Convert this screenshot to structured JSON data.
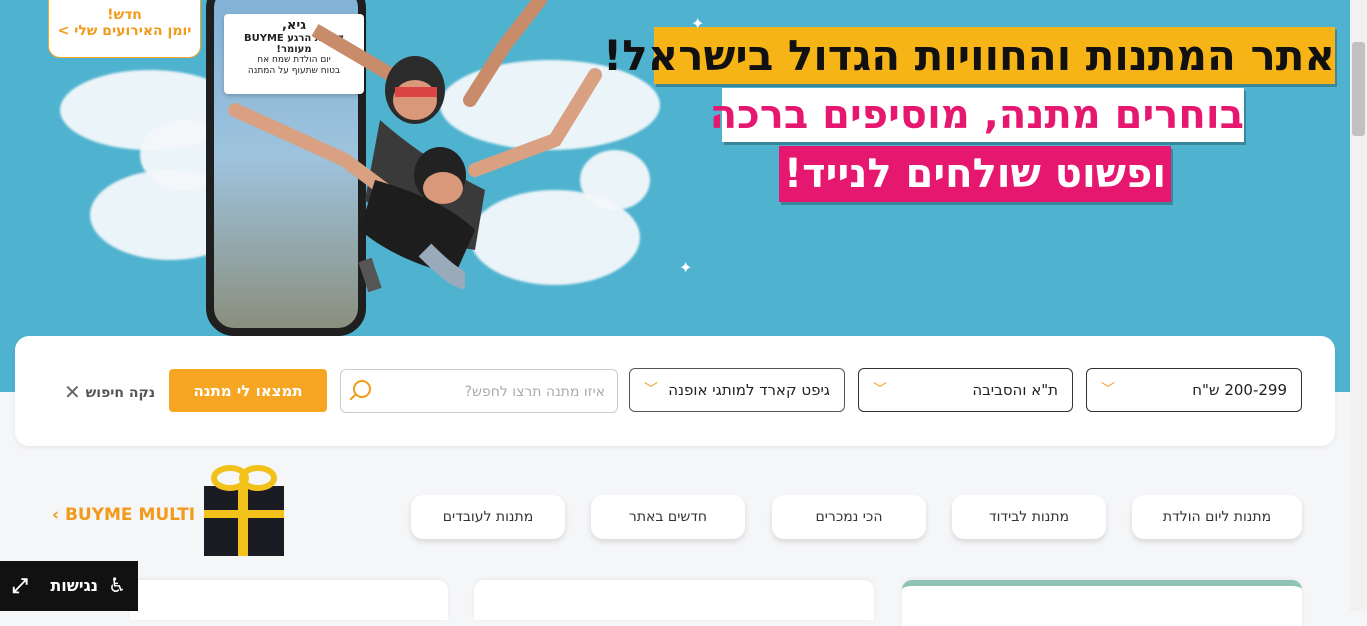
{
  "hero": {
    "events_new": "חדש!",
    "events_link": "יומן האירועים שלי >",
    "phone_card": {
      "line1": "גיא,",
      "line2": "קיבלת הרגע BUYME מעומר!",
      "line3": "יום הולדת שמח אח",
      "line4": "בטוח שתעוף על המתנה"
    },
    "headline_1": "אתר המתנות והחוויות הגדול בישראל!",
    "headline_2": "בוחרים מתנה, מוסיפים ברכה",
    "headline_3": "ופשוט שולחים לנייד!",
    "colors": {
      "sky": "#4fb3cf",
      "yellow": "#f6b417",
      "pink": "#e6176f",
      "accent": "#f6a623"
    }
  },
  "search": {
    "price_value": "200-299 ש\"ח",
    "area_value": "ת\"א והסביבה",
    "category_value": "גיפט קארד למותגי אופנה",
    "input_placeholder": "איזו מתנה תרצו לחפש?",
    "find_button": "תמצאו לי מתנה",
    "clear_label": "נקה חיפוש"
  },
  "categories": [
    "מתנות ליום הולדת",
    "מתנות לבידוד",
    "הכי נמכרים",
    "חדשים באתר",
    "מתנות לעובדים"
  ],
  "multi_link": "BUYME MULTI",
  "accessibility": {
    "label": "נגישות"
  }
}
